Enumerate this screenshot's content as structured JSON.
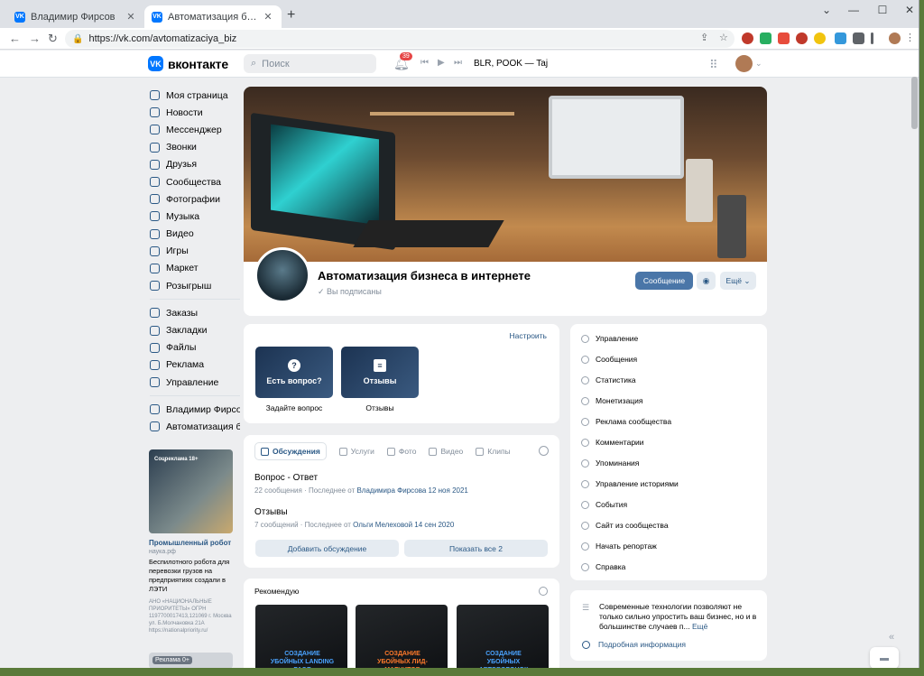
{
  "browser": {
    "tabs": [
      {
        "title": "Владимир Фирсов",
        "icon": "vk-icon"
      },
      {
        "title": "Автоматизация бизнеса в инте",
        "icon": "vk-icon",
        "active": true
      }
    ],
    "new_tab": "+",
    "url": "https://vk.com/avtomatizaciya_biz"
  },
  "header": {
    "logo_text": "вконтакте",
    "search_placeholder": "Поиск",
    "notification_badge": "39",
    "now_playing": "BLR, POOK — Taj"
  },
  "sidebar": {
    "items": [
      {
        "label": "Моя страница"
      },
      {
        "label": "Новости"
      },
      {
        "label": "Мессенджер"
      },
      {
        "label": "Звонки"
      },
      {
        "label": "Друзья"
      },
      {
        "label": "Сообщества"
      },
      {
        "label": "Фотографии"
      },
      {
        "label": "Музыка"
      },
      {
        "label": "Видео"
      },
      {
        "label": "Игры"
      },
      {
        "label": "Маркет"
      },
      {
        "label": "Розыгрыш"
      }
    ],
    "items2": [
      {
        "label": "Заказы"
      },
      {
        "label": "Закладки"
      },
      {
        "label": "Файлы"
      },
      {
        "label": "Реклама"
      },
      {
        "label": "Управление"
      }
    ],
    "items3": [
      {
        "label": "Владимир Фирсов"
      },
      {
        "label": "Автоматизация б..."
      }
    ]
  },
  "ad": {
    "badge": "Соцреклама 18+",
    "title": "Промышленный робот",
    "domain": "наука.рф",
    "body": "Беспилотного робота для перевозки грузов на предприятиях создали в ЛЭТИ",
    "footer": "АНО «НАЦИОНАЛЬНЫЕ ПРИОРИТЕТЫ» ОГРН 1197700017413,121069 г. Москва ул. Б.Молчановка 21А https://nationalpriority.ru/",
    "badge2": "Реклама 0+"
  },
  "group": {
    "name": "Автоматизация бизнеса в интернете",
    "subscribed": "Вы подписаны",
    "btn_message": "Сообщение",
    "btn_more": "Ещё"
  },
  "quick": {
    "configure": "Настроить",
    "tiles": [
      {
        "label": "Есть вопрос?",
        "caption": "Задайте вопрос"
      },
      {
        "label": "Отзывы",
        "caption": "Отзывы"
      }
    ]
  },
  "discussions": {
    "tabs": [
      "Обсуждения",
      "Услуги",
      "Фото",
      "Видео",
      "Клипы"
    ],
    "topics": [
      {
        "title": "Вопрос - Ответ",
        "meta": "22 сообщения · Последнее от ",
        "author": "Владимира Фирсова 12 ноя 2021"
      },
      {
        "title": "Отзывы",
        "meta": "7 сообщений · Последнее от ",
        "author": "Ольги Мелеховой 14 сен 2020"
      }
    ],
    "btn_add": "Добавить обсуждение",
    "btn_show": "Показать все 2"
  },
  "recommend": {
    "title": "Рекомендую",
    "books": [
      {
        "title": "СОЗДАНИЕ УБОЙНЫХ LANDING PAGE",
        "color": "#4aa3ff"
      },
      {
        "title": "СОЗДАНИЕ УБОЙНЫХ ЛИД-МАГНИТОВ",
        "color": "#ff7a2a"
      },
      {
        "title": "СОЗДАНИЕ УБОЙНЫХ АВТОВОРОНОК",
        "color": "#4aa3ff"
      }
    ]
  },
  "management": {
    "items": [
      {
        "label": "Управление"
      },
      {
        "label": "Сообщения"
      },
      {
        "label": "Статистика"
      },
      {
        "label": "Монетизация"
      },
      {
        "label": "Реклама сообщества"
      },
      {
        "label": "Комментарии"
      },
      {
        "label": "Упоминания"
      },
      {
        "label": "Управление историями"
      },
      {
        "label": "События"
      },
      {
        "label": "Сайт из сообщества"
      },
      {
        "label": "Начать репортаж"
      },
      {
        "label": "Справка"
      }
    ]
  },
  "about": {
    "text": "Современные технологии позволяют не только сильно упростить ваш бизнес, но и в большинстве случаев п...",
    "show_more": "Ещё",
    "more_info": "Подробная информация"
  },
  "colors": {
    "accent": "#4a76a8",
    "link": "#2a5885",
    "vk": "#0077ff",
    "bg": "#edeef0"
  }
}
